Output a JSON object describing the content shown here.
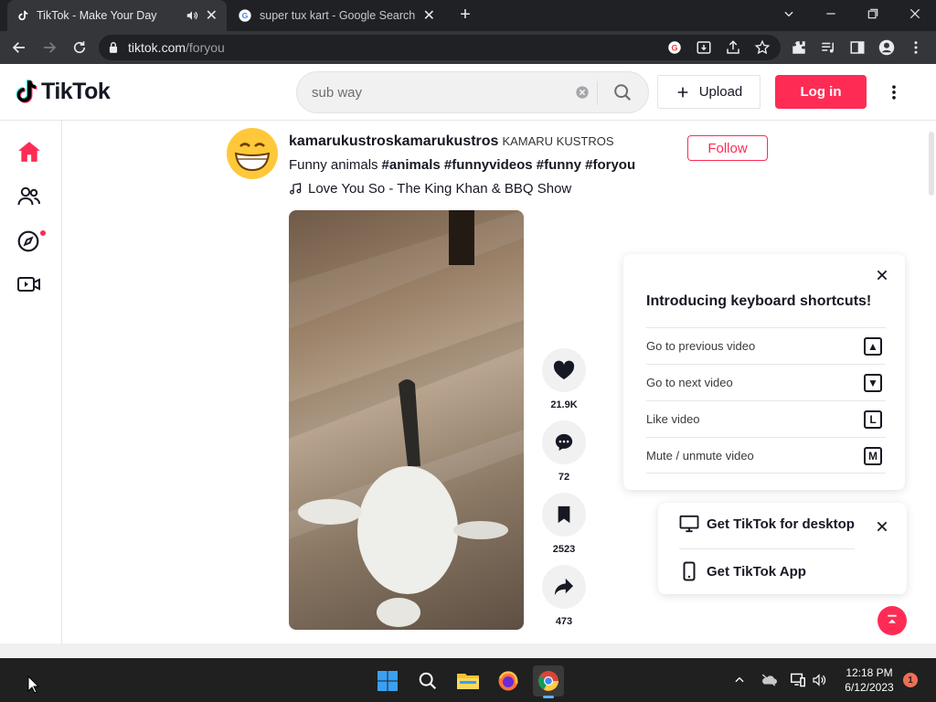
{
  "browser": {
    "tabs": [
      {
        "title": "TikTok - Make Your Day",
        "active": true
      },
      {
        "title": "super tux kart - Google Search",
        "active": false
      }
    ],
    "url_host": "tiktok.com",
    "url_path": "/foryou"
  },
  "header": {
    "logo": "TikTok",
    "search_value": "sub way",
    "upload_label": "Upload",
    "login_label": "Log in"
  },
  "sidebar": {
    "items": [
      {
        "icon": "home-icon",
        "active": true
      },
      {
        "icon": "following-icon",
        "active": false
      },
      {
        "icon": "explore-icon",
        "active": false,
        "badge": true
      },
      {
        "icon": "live-icon",
        "active": false
      }
    ]
  },
  "post": {
    "author": "kamarukustroskamarukustros",
    "nickname": "KAMARU KUSTROS",
    "follow_label": "Follow",
    "caption": "Funny animals",
    "hashtags": "#animals #funnyvideos #funny #foryou",
    "music": "Love You So - The King Khan & BBQ Show",
    "likes": "21.9K",
    "comments": "72",
    "saves": "2523",
    "shares": "473"
  },
  "keyboard_shortcuts": {
    "title": "Introducing keyboard shortcuts!",
    "rows": [
      {
        "label": "Go to previous video",
        "key": "▲"
      },
      {
        "label": "Go to next video",
        "key": "▼"
      },
      {
        "label": "Like video",
        "key": "L"
      },
      {
        "label": "Mute / unmute video",
        "key": "M"
      }
    ]
  },
  "get_app": {
    "desktop_label": "Get TikTok for desktop",
    "app_label": "Get TikTok App"
  },
  "taskbar": {
    "time": "12:18 PM",
    "date": "6/12/2023",
    "notification_count": "1"
  },
  "colors": {
    "brand": "#fe2c55",
    "chrome_dark": "#202124",
    "chrome_toolbar": "#35363a"
  }
}
